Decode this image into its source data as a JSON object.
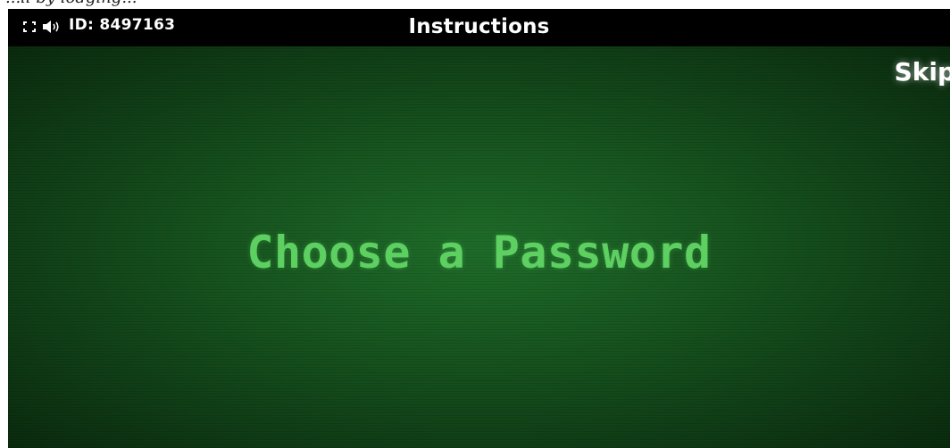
{
  "page_caption": "...ll by lodging...",
  "topbar": {
    "fullscreen_icon": "fullscreen-icon",
    "sound_icon": "speaker-icon",
    "id_label": "ID: 8497163",
    "title": "Instructions"
  },
  "screen": {
    "skip_label": "Skip",
    "headline": "Choose a Password"
  },
  "colors": {
    "topbar_bg": "#000000",
    "screen_green": "#17551f",
    "headline_green": "#5dd061",
    "text_white": "#ffffff"
  }
}
